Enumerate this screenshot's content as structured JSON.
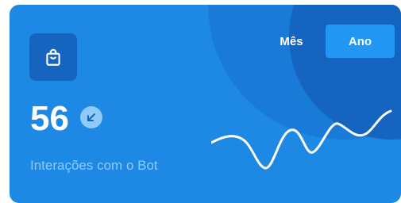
{
  "widget": {
    "value": "56",
    "label": "Interações com o Bot",
    "icon": "shopping-bag-icon",
    "trend_icon": "arrow-down-left-icon"
  },
  "toggle": {
    "options": [
      "Mês",
      "Ano"
    ],
    "selected": "Ano"
  },
  "colors": {
    "card": "#1e88e5",
    "icon_box": "#1565c0",
    "selected_button": "#2196f3",
    "label": "#90caf9",
    "line": "#ffffff"
  }
}
